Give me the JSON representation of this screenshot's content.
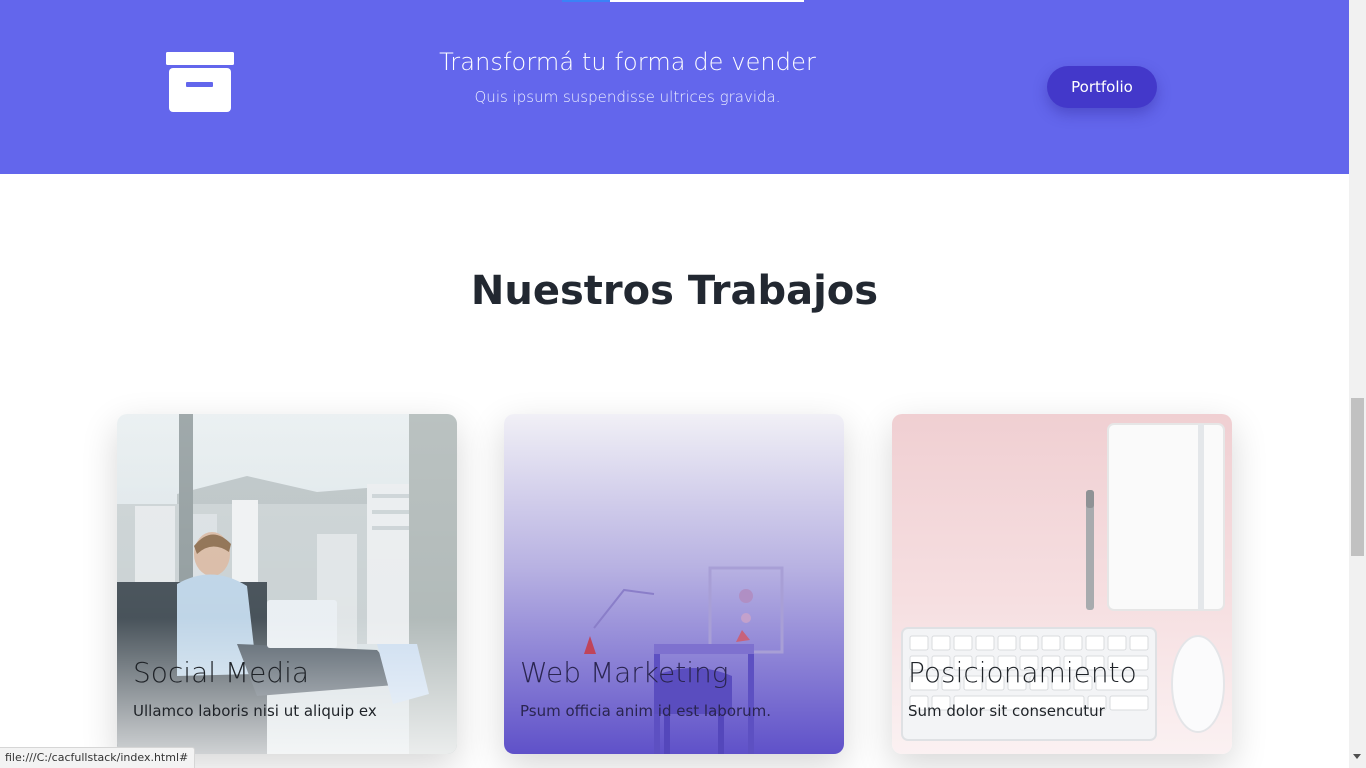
{
  "cta": {
    "title": "Transformá tu forma de vender",
    "subtitle": "Quis ipsum suspendisse ultrices gravida.",
    "button_label": "Portfolio",
    "icon": "archive-box-icon",
    "band_color": "#6366ec",
    "button_color": "#4338ca",
    "scroll_progress": 0.2
  },
  "works": {
    "title": "Nuestros Trabajos",
    "cards": [
      {
        "title": "Social Media",
        "text": "Ullamco laboris nisi ut aliquip ex",
        "image": "man-with-laptop-photo"
      },
      {
        "title": "Web Marketing",
        "text": "Psum officia anim id est laborum.",
        "image": "office-chair-photo"
      },
      {
        "title": "Posicionamiento",
        "text": "Sum dolor sit consencutur",
        "image": "desk-keyboard-notebook-photo"
      }
    ]
  },
  "status_bar": {
    "url": "file:///C:/cacfullstack/index.html#"
  }
}
